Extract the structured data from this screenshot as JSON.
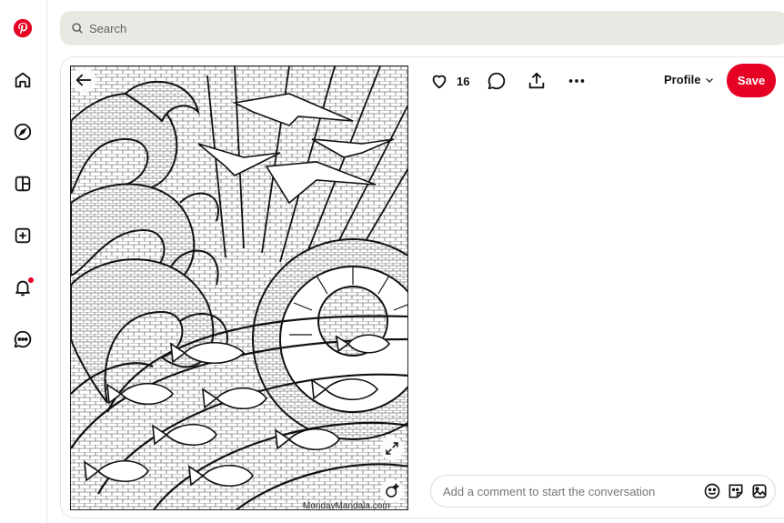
{
  "sidebar": {
    "items": [
      {
        "name": "pinterest-logo-icon"
      },
      {
        "name": "home-icon"
      },
      {
        "name": "explore-icon"
      },
      {
        "name": "boards-icon"
      },
      {
        "name": "create-icon"
      },
      {
        "name": "notifications-icon"
      },
      {
        "name": "messages-icon"
      }
    ],
    "brand_color": "#e60023"
  },
  "search": {
    "placeholder": "Search"
  },
  "pin": {
    "like_count": "16",
    "watermark": "MondayMandala.com"
  },
  "header": {
    "profile_label": "Profile",
    "save_label": "Save"
  },
  "comment": {
    "placeholder": "Add a comment to start the conversation"
  }
}
